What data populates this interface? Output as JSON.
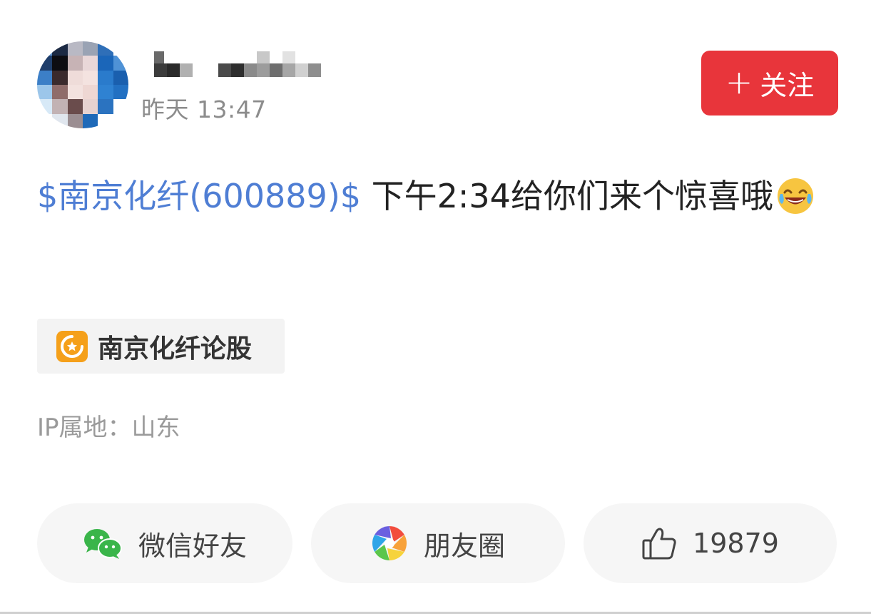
{
  "post": {
    "timestamp": "昨天 13:47",
    "follow_label": "关注",
    "stock_tag": "$南京化纤(600889)$",
    "text_line": " 下午2:34给你们来个惊喜哦",
    "topic_label": "南京化纤论股",
    "ip_location": "IP属地：山东"
  },
  "actions": {
    "wechat_label": "微信好友",
    "moments_label": "朋友圈",
    "like_count": "19879"
  },
  "icons": {
    "avatar": "pixelated-avatar",
    "follow": "plus-icon",
    "emoji": "laughing-tears-emoji",
    "topic": "topic-badge-icon",
    "wechat": "wechat-icon",
    "moments": "moments-shutter-icon",
    "like": "thumbs-up-icon"
  },
  "colors": {
    "accent_red": "#e8353b",
    "link_blue": "#4f7ed4",
    "topic_orange": "#f5a01a",
    "wechat_green": "#3ab54a"
  }
}
